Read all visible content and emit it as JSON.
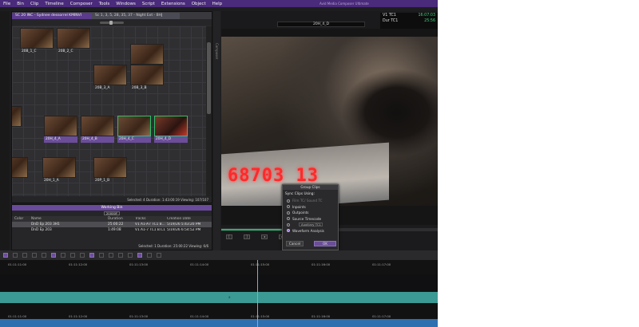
{
  "menu": {
    "items": [
      "File",
      "Bin",
      "Clip",
      "Timeline",
      "Composer",
      "Tools",
      "Windows",
      "Script",
      "Extensions",
      "Object",
      "Help"
    ],
    "app_title": "Avid Media Composer Ultimate"
  },
  "bin": {
    "tabs": [
      "SC 20 INC - Sydnee dessorrel KMINVI",
      "Sc 1, 3, 5, 28, 35, 37 - Night Ext - BHJ"
    ],
    "clips": [
      "20B_1_C",
      "20B_2_C",
      "20B_3_Ext",
      "20B_3_A",
      "20B_3_B",
      "20H_4_A",
      "20H_4_B",
      "20H_4_C",
      "20H_4_D",
      "20H_1_A",
      "20P_1_B"
    ],
    "status": "Selected: 4  Duration: 1:43:00:19    Viewing: 107/107"
  },
  "composer_label": "Composer",
  "working_bin": {
    "title": "Working Bin",
    "toolbar_box": "20000F",
    "headers": [
      "Color",
      "Name",
      "Duration",
      "Tracks",
      "Creation Date"
    ],
    "rows": [
      {
        "color": "",
        "name": "DnD Ep 203 3H1",
        "duration": "25:00:22",
        "tracks": "V1 A1-A7 TC1 B...",
        "date": "5/19/26 5:43:20 PM"
      },
      {
        "color": "",
        "name": "DnD Ep 203",
        "duration": "1:49:08",
        "tracks": "V1 A1-7 TC1 B.C1",
        "date": "5/19/26 6:54:52 PM"
      }
    ],
    "status": "Selected: 1  Duration: 25:00:22    Viewing: 6/6"
  },
  "viewer": {
    "clip_name": "20H_4_D",
    "tc_rows": [
      {
        "label": "V1  TC1",
        "value": "16:07:03"
      },
      {
        "label": "Dur  TC1",
        "value": "25:56"
      }
    ],
    "led_readout": "68703 13"
  },
  "dialog": {
    "title": "Group Clips",
    "subtitle": "Sync Clips Using:",
    "options": [
      {
        "label": "Film TC/ Sound TC",
        "selected": false,
        "enabled": false
      },
      {
        "label": "Inpoints",
        "selected": false,
        "enabled": true
      },
      {
        "label": "Outpoints",
        "selected": false,
        "enabled": true
      },
      {
        "label": "Source Timecode",
        "selected": false,
        "enabled": true
      },
      {
        "label": "Auxiliary TC1",
        "selected": false,
        "enabled": false
      },
      {
        "label": "Waveform Analysis",
        "selected": true,
        "enabled": true
      }
    ],
    "dropdown": "Auxiliary TC1",
    "cancel": "Cancel",
    "ok": "OK"
  },
  "timeline": {
    "ruler_labels": [
      "01:11:11:00",
      "01:11:12:00",
      "01:11:13:00",
      "01:11:14:00",
      "01:11:15:00",
      "01:11:16:00",
      "01:11:17:00",
      "01:11:18:00"
    ],
    "track_marker": "a"
  },
  "colors": {
    "menubar": "#4a2a7a",
    "accent_purple": "#6b4d9a",
    "timecode_green": "#43d27a",
    "selection_green": "#2fbf6a",
    "track_teal": "#3b9a93",
    "track_blue": "#2e6fb0",
    "led_red": "#ff2a2a"
  }
}
